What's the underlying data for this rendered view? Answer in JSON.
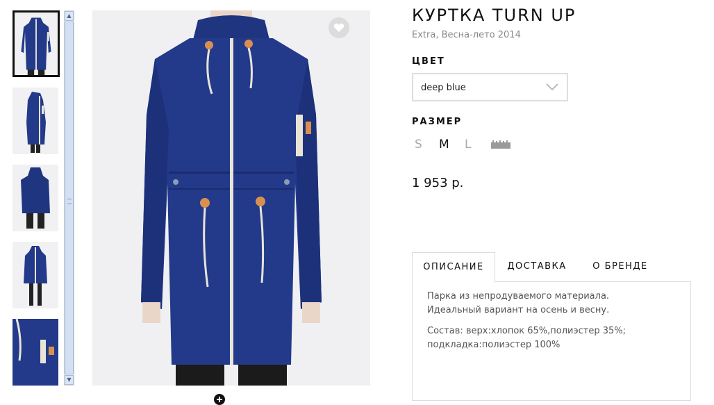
{
  "product": {
    "title": "КУРТКА TURN UP",
    "subtitle": "Extra, Весна-лето 2014",
    "color_label": "ЦВЕТ",
    "color_value": "deep blue",
    "size_label": "РАЗМЕР",
    "sizes": [
      "S",
      "M",
      "L"
    ],
    "selected_size": "M",
    "price": "1 953 р."
  },
  "tabs": {
    "description": "ОПИСАНИЕ",
    "delivery": "ДОСТАВКА",
    "brand": "О БРЕНДЕ",
    "active": "description"
  },
  "description": {
    "paragraph1": "Парка из непродуваемого материала. Идеальный вариант на осень и весну.",
    "paragraph2": "Состав: верх:хлопок 65%,полиэстер 35%; подкладка:полиэстер 100%"
  },
  "gallery": {
    "thumbnail_count": 5,
    "selected_index": 0
  },
  "colors": {
    "jacket": "#233a8a",
    "jacket_dark": "#1a2c6e",
    "zipper": "#e8e4d8",
    "toggle": "#d9904f",
    "accent_text": "#111111",
    "muted_text": "#888888"
  },
  "icons": {
    "favorite": "heart-icon",
    "dropdown": "chevron-down-icon",
    "size_chart": "ruler-icon",
    "zoom": "zoom-plus-icon"
  }
}
